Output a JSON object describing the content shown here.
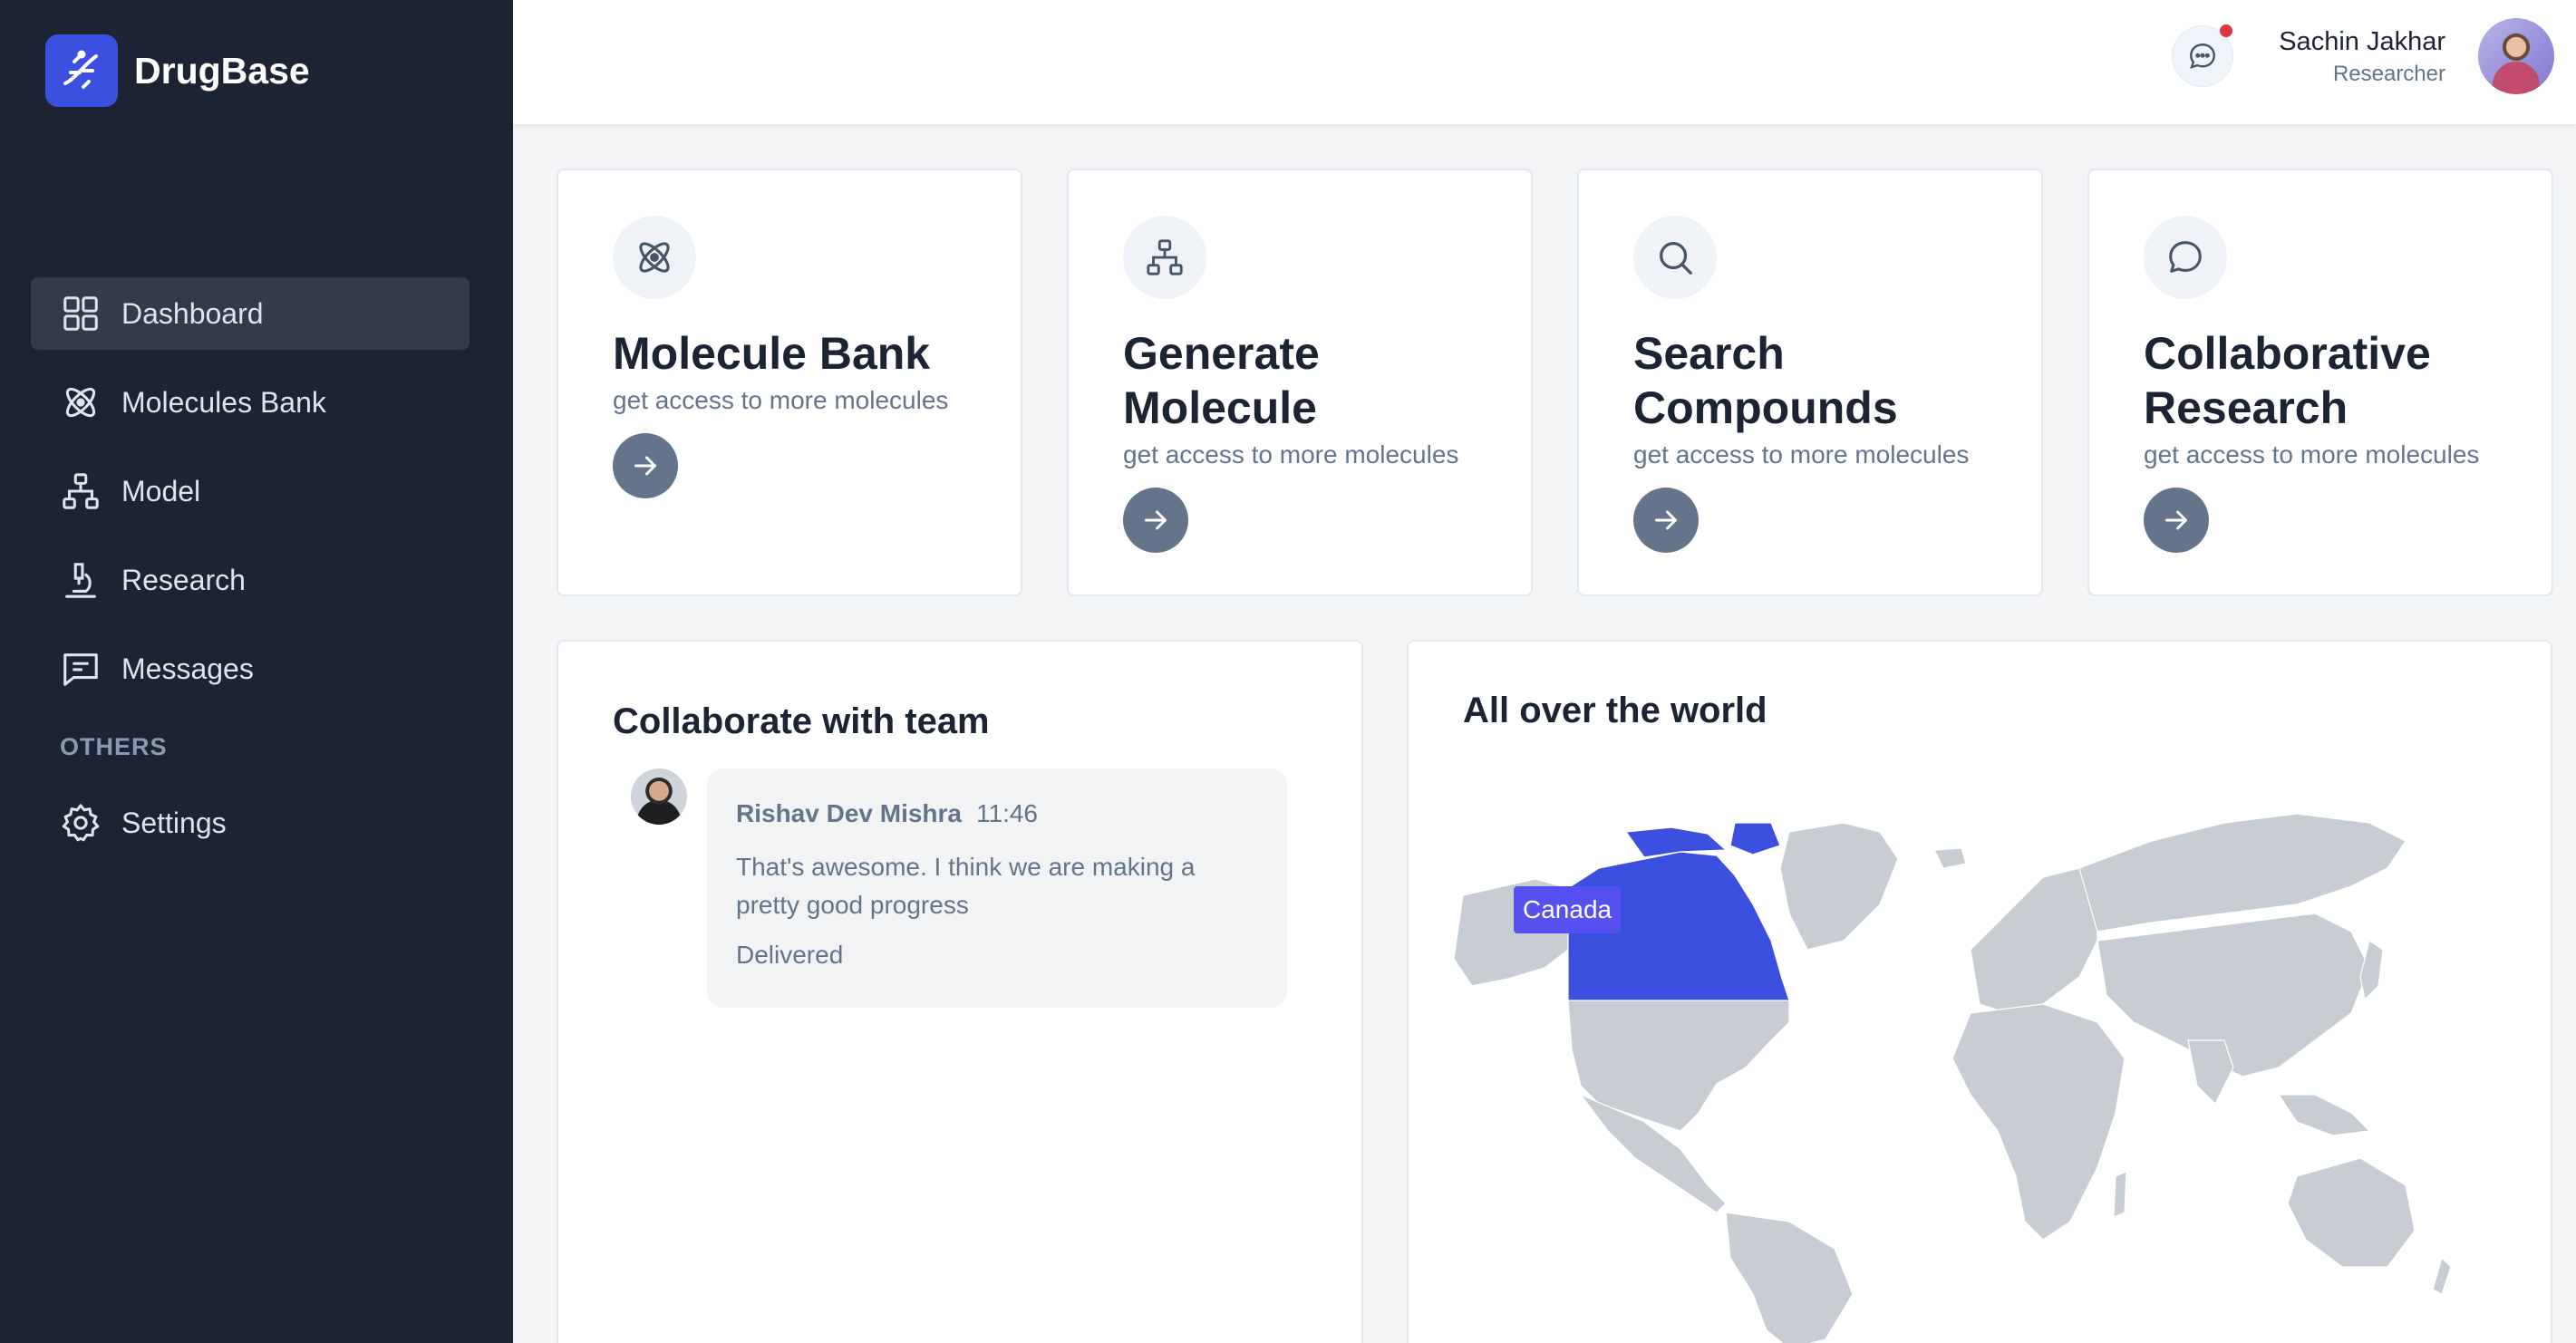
{
  "app": {
    "name": "DrugBase"
  },
  "sidebar": {
    "items": [
      {
        "label": "Dashboard",
        "icon": "grid-icon",
        "active": true
      },
      {
        "label": "Molecules Bank",
        "icon": "atom-icon"
      },
      {
        "label": "Model",
        "icon": "hierarchy-icon"
      },
      {
        "label": "Research",
        "icon": "microscope-icon"
      },
      {
        "label": "Messages",
        "icon": "message-square-icon"
      }
    ],
    "section_label": "OTHERS",
    "others": [
      {
        "label": "Settings",
        "icon": "gear-icon"
      }
    ]
  },
  "header": {
    "user_name": "Sachin Jakhar",
    "user_role": "Researcher",
    "has_notification": true
  },
  "cards": [
    {
      "title": "Molecule Bank",
      "subtitle": "get access to more molecules",
      "icon": "atom-icon"
    },
    {
      "title": "Generate Molecule",
      "subtitle": "get access to more molecules",
      "icon": "hierarchy-icon"
    },
    {
      "title": "Search Compounds",
      "subtitle": "get access to more molecules",
      "icon": "search-icon"
    },
    {
      "title": "Collaborative Research",
      "subtitle": "get access to more molecules",
      "icon": "chat-bubble-icon"
    }
  ],
  "collab": {
    "title": "Collaborate with team",
    "message": {
      "author": "Rishav Dev Mishra",
      "time": "11:46",
      "text": "That's awesome. I think we are making a pretty good progress",
      "status": "Delivered"
    }
  },
  "world": {
    "title": "All over the world",
    "highlight_country": "Canada",
    "tooltip": "Canada"
  },
  "colors": {
    "sidebar_bg": "#1c2434",
    "accent": "#3c50e0",
    "highlight": "#3c50e0",
    "land": "#c8cdd4"
  }
}
